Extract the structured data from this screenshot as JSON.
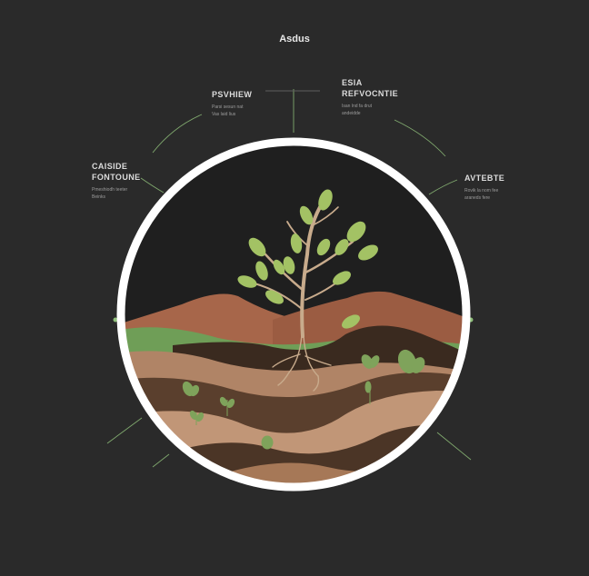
{
  "title": "Asdus",
  "labels": {
    "top_left": {
      "heading": "PSVHIEW",
      "lines": [
        "Parsi sesun nat",
        "Vas laid lius"
      ]
    },
    "top_right": {
      "heading_line1": "ESIA",
      "heading_line2": "REFVOCNTIE",
      "lines": [
        "Isan lnd fa drut",
        "andeidde"
      ]
    },
    "left": {
      "heading_line1": "CAISIDE",
      "heading_line2": "FONTOUNE",
      "lines": [
        "Pmeshiodh teeter",
        "Beinks"
      ]
    },
    "right": {
      "heading": "AVTEBTE",
      "lines": [
        "Rovik la nom fee",
        "araneds fere"
      ]
    }
  },
  "colors": {
    "background": "#2a2a2a",
    "ring": "#ffffff",
    "circle_bg": "#1f1f1f",
    "connector": "#8fbf7a",
    "mountain": "#a7664a",
    "grass": "#6f9e57",
    "soil_light": "#b08466",
    "soil_dark": "#4b3526",
    "trunk": "#c8ab8c",
    "leaf": "#a3c264"
  },
  "icons": [
    "sprout-icon",
    "leaf-icon"
  ]
}
